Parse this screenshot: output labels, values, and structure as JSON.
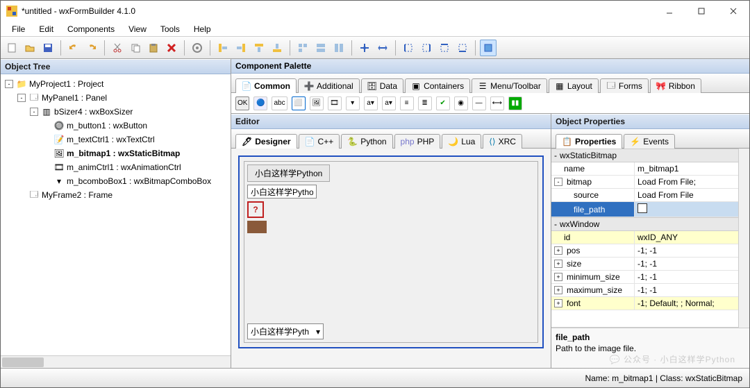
{
  "window": {
    "title": "*untitled - wxFormBuilder 4.1.0"
  },
  "menus": [
    "File",
    "Edit",
    "Components",
    "View",
    "Tools",
    "Help"
  ],
  "object_tree": {
    "header": "Object Tree",
    "nodes": [
      {
        "depth": 0,
        "expander": "-",
        "icon": "project",
        "label": "MyProject1 : Project"
      },
      {
        "depth": 1,
        "expander": "-",
        "icon": "panel",
        "label": "MyPanel1 : Panel"
      },
      {
        "depth": 2,
        "expander": "-",
        "icon": "sizer",
        "label": "bSizer4 : wxBoxSizer"
      },
      {
        "depth": 3,
        "expander": "",
        "icon": "button",
        "label": "m_button1 : wxButton"
      },
      {
        "depth": 3,
        "expander": "",
        "icon": "textctrl",
        "label": "m_textCtrl1 : wxTextCtrl"
      },
      {
        "depth": 3,
        "expander": "",
        "icon": "bitmap",
        "label": "m_bitmap1 : wxStaticBitmap",
        "selected": true
      },
      {
        "depth": 3,
        "expander": "",
        "icon": "anim",
        "label": "m_animCtrl1 : wxAnimationCtrl"
      },
      {
        "depth": 3,
        "expander": "",
        "icon": "combo",
        "label": "m_bcomboBox1 : wxBitmapComboBox"
      },
      {
        "depth": 1,
        "expander": "",
        "icon": "frame",
        "label": "MyFrame2 : Frame"
      }
    ]
  },
  "palette": {
    "header": "Component Palette",
    "tabs": [
      "Common",
      "Additional",
      "Data",
      "Containers",
      "Menu/Toolbar",
      "Layout",
      "Forms",
      "Ribbon"
    ],
    "active": 0
  },
  "editor": {
    "header": "Editor",
    "tabs": [
      "Designer",
      "C++",
      "Python",
      "PHP",
      "Lua",
      "XRC"
    ],
    "active": 0,
    "button_label": "小白这样学Python",
    "text_value": "小白这样学Python",
    "bitmap_glyph": "?",
    "combo_value": "小白这样学Pyth"
  },
  "props": {
    "header": "Object Properties",
    "tabs": [
      "Properties",
      "Events"
    ],
    "active": 0,
    "cat1": "wxStaticBitmap",
    "rows1": [
      {
        "k": "name",
        "v": "m_bitmap1"
      },
      {
        "k": "bitmap",
        "v": "Load From File;",
        "exp": "-"
      },
      {
        "k": "source",
        "v": "Load From File",
        "indent": true
      },
      {
        "k": "file_path",
        "v": "",
        "indent": true,
        "selected": true,
        "box": true
      }
    ],
    "cat2": "wxWindow",
    "rows2": [
      {
        "k": "id",
        "v": "wxID_ANY",
        "y": true
      },
      {
        "k": "pos",
        "v": "-1; -1",
        "exp": "+"
      },
      {
        "k": "size",
        "v": "-1; -1",
        "exp": "+"
      },
      {
        "k": "minimum_size",
        "v": "-1; -1",
        "exp": "+"
      },
      {
        "k": "maximum_size",
        "v": "-1; -1",
        "exp": "+"
      },
      {
        "k": "font",
        "v": "-1; Default; ; Normal;",
        "exp": "+",
        "y": true
      }
    ],
    "desc_title": "file_path",
    "desc_text": "Path to the image file."
  },
  "status": {
    "right": "Name: m_bitmap1 | Class: wxStaticBitmap"
  },
  "watermark": "公众号 · 小白这样学Python"
}
